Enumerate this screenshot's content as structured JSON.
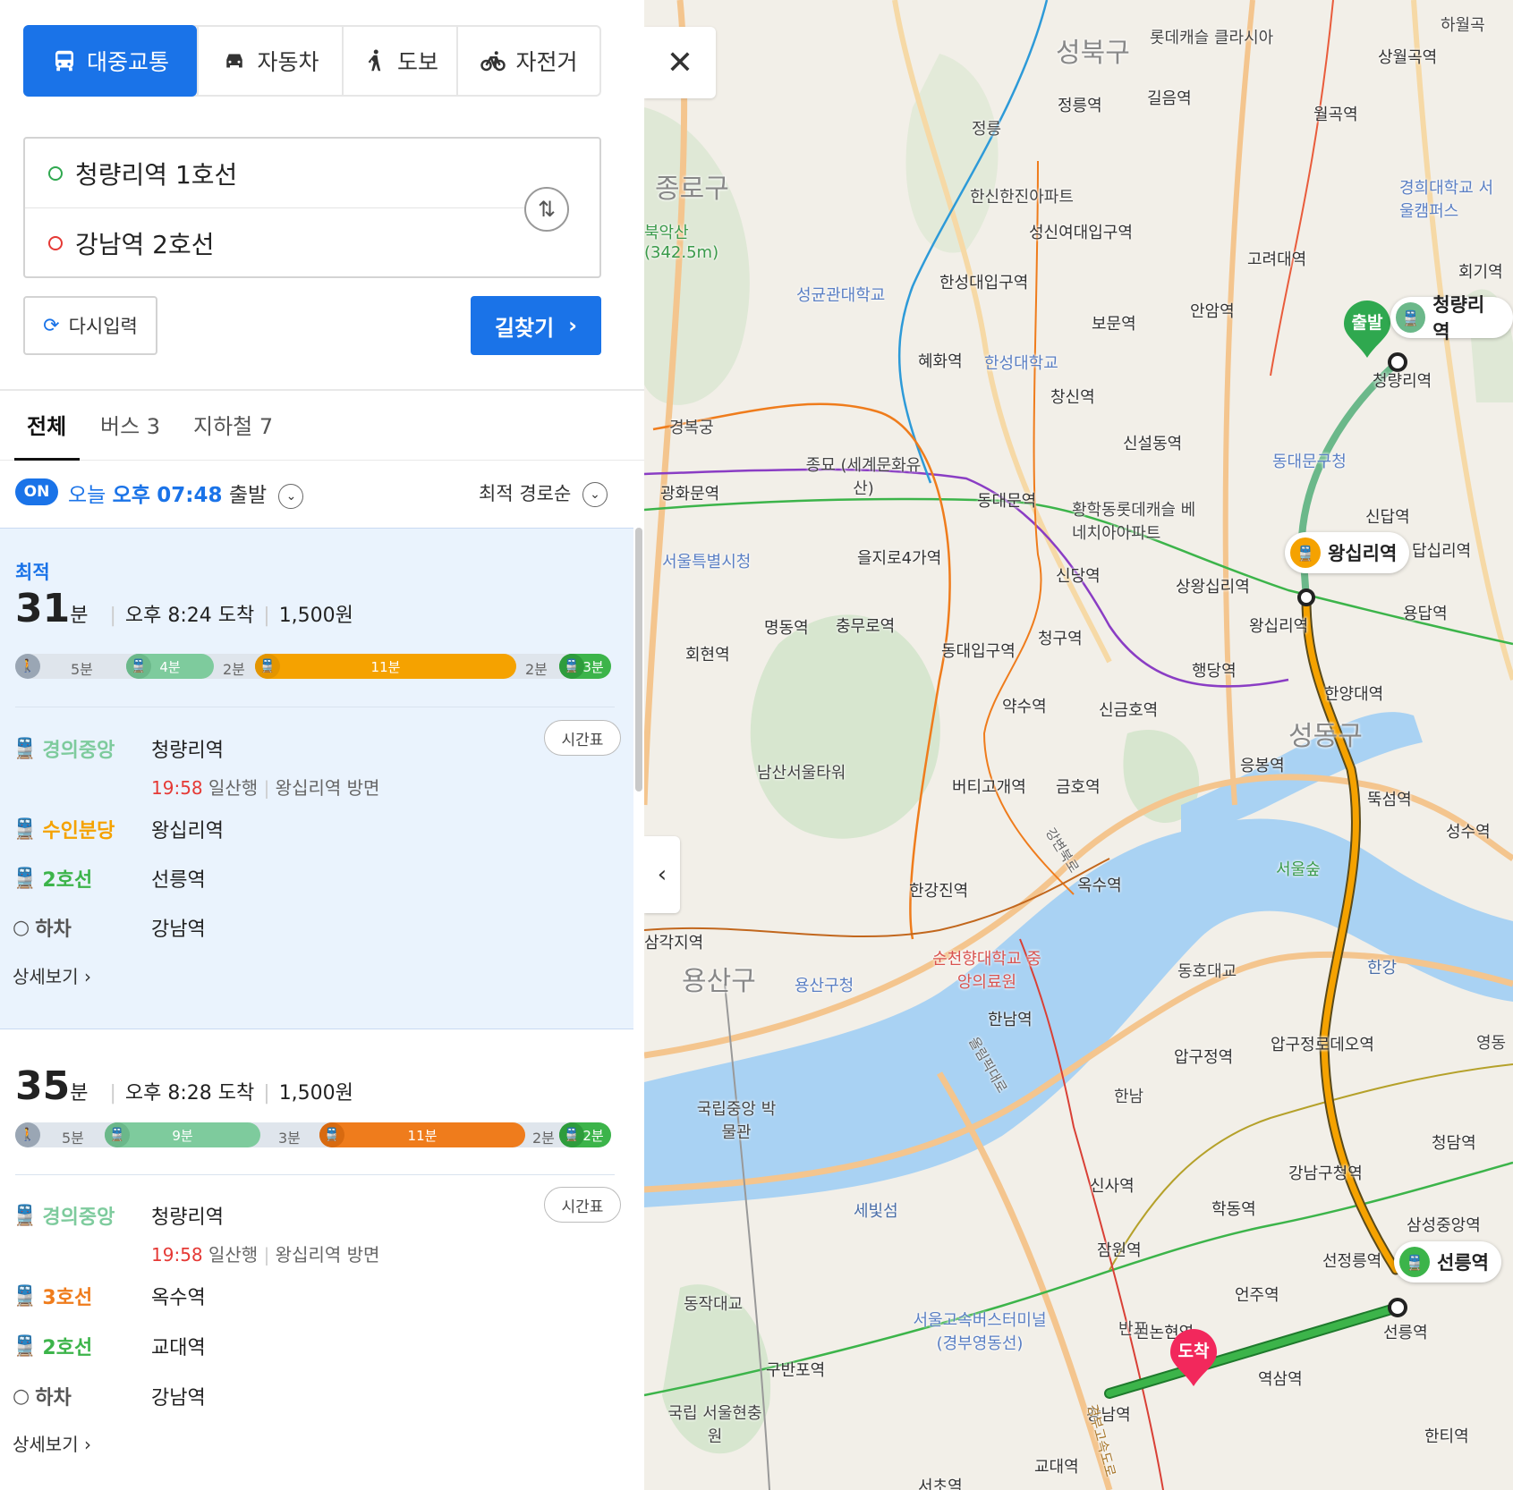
{
  "modes": [
    {
      "label": "대중교통",
      "icon": "bus-icon",
      "active": true
    },
    {
      "label": "자동차",
      "icon": "car-icon",
      "active": false
    },
    {
      "label": "도보",
      "icon": "walk-icon",
      "active": false
    },
    {
      "label": "자전거",
      "icon": "bike-icon",
      "active": false
    }
  ],
  "route": {
    "origin": "청량리역 1호선",
    "destination": "강남역 2호선"
  },
  "buttons": {
    "reset": "다시입력",
    "search": "길찾기"
  },
  "tabs": [
    {
      "label": "전체"
    },
    {
      "label": "버스 3"
    },
    {
      "label": "지하철 7"
    }
  ],
  "departure": {
    "badge": "ON",
    "prefix": "오늘",
    "ampm": "오후",
    "time": "07:48",
    "suffix": "출발",
    "sort": "최적 경로순"
  },
  "results": [
    {
      "tag": "최적",
      "minutes": "31",
      "unit": "분",
      "arrival": "오후 8:24 도착",
      "fare": "1,500원",
      "segments": [
        {
          "type": "walk",
          "label": "5분"
        },
        {
          "type": "rail",
          "label": "4분",
          "color": "#7ecb9d"
        },
        {
          "type": "walk",
          "label": "2분"
        },
        {
          "type": "rail",
          "label": "11분",
          "color": "#f5a200"
        },
        {
          "type": "walk",
          "label": "2분"
        },
        {
          "type": "rail",
          "label": "3분",
          "color": "#3cb44a"
        }
      ],
      "steps": [
        {
          "line": "경의중앙",
          "color": "#7ecb9d",
          "station": "청량리역",
          "time": "19:58",
          "info": "일산행",
          "direction": "왕십리역 방면",
          "timetable": "시간표"
        },
        {
          "line": "수인분당",
          "color": "#f5a200",
          "station": "왕십리역"
        },
        {
          "line": "2호선",
          "color": "#3cb44a",
          "station": "선릉역"
        },
        {
          "line": "하차",
          "color": "#555",
          "station": "강남역"
        }
      ],
      "detail": "상세보기"
    },
    {
      "minutes": "35",
      "unit": "분",
      "arrival": "오후 8:28 도착",
      "fare": "1,500원",
      "segments": [
        {
          "type": "walk",
          "label": "5분"
        },
        {
          "type": "rail",
          "label": "9분",
          "color": "#7ecb9d"
        },
        {
          "type": "walk",
          "label": "3분"
        },
        {
          "type": "rail",
          "label": "11분",
          "color": "#ef7c1c"
        },
        {
          "type": "walk",
          "label": "2분"
        },
        {
          "type": "rail",
          "label": "2분",
          "color": "#3cb44a"
        }
      ],
      "steps": [
        {
          "line": "경의중앙",
          "color": "#7ecb9d",
          "station": "청량리역",
          "time": "19:58",
          "info": "일산행",
          "direction": "왕십리역 방면",
          "timetable": "시간표"
        },
        {
          "line": "3호선",
          "color": "#ef7c1c",
          "station": "옥수역"
        },
        {
          "line": "2호선",
          "color": "#3cb44a",
          "station": "교대역"
        },
        {
          "line": "하차",
          "color": "#555",
          "station": "강남역"
        }
      ],
      "detail": "상세보기"
    }
  ],
  "map": {
    "districts": [
      "성북구",
      "종로구",
      "성동구",
      "용산구"
    ],
    "markers": {
      "start_pin": "출발",
      "start_station": "청량리역",
      "transfer_station": "왕십리역",
      "end_station": "선릉역",
      "end_pin": "도착"
    },
    "labels": [
      "롯데캐슬 클라시아",
      "정릉역",
      "정릉",
      "길음역",
      "하월곡",
      "상월곡역",
      "월곡역",
      "한신한진아파트",
      "성신여대입구역",
      "경희대학교 서울캠퍼스",
      "북악산 (342.5m)",
      "고려대역",
      "회기역",
      "성균관대학교",
      "한성대입구역",
      "보문역",
      "안암역",
      "청량리역",
      "혜화역",
      "한성대학교",
      "창신역",
      "경복궁",
      "신설동역",
      "동대문구청",
      "종묘 (세계문화유산)",
      "광화문역",
      "동대문역",
      "황학동롯데캐슬 베네치아아파트",
      "신답역",
      "답십리역",
      "서울특별시청",
      "을지로4가역",
      "신당역",
      "상왕십리역",
      "왕십리역",
      "용답역",
      "명동역",
      "충무로역",
      "회현역",
      "동대입구역",
      "청구역",
      "행당역",
      "한양대역",
      "약수역",
      "신금호역",
      "응봉역",
      "남산서울타워",
      "버티고개역",
      "금호역",
      "뚝섬역",
      "성수역",
      "서울숲",
      "한강진역",
      "옥수역",
      "동호대교",
      "한강",
      "삼각지역",
      "순천향대학교 중앙의료원",
      "용산구청",
      "한남역",
      "압구정역",
      "압구정로데오역",
      "영동",
      "한남",
      "국립중앙 박물관",
      "신사역",
      "강남구청역",
      "청담역",
      "세빛섬",
      "학동역",
      "삼성중앙역",
      "잠원역",
      "선정릉역",
      "동작대교",
      "서울고속버스터미널 (경부영동선)",
      "언주역",
      "신논현역",
      "반포",
      "선릉역",
      "구반포역",
      "역삼역",
      "국립 서울현충원",
      "강남역",
      "한티역",
      "교대역",
      "서초역",
      "강변북로",
      "올림픽대로",
      "경부고속도로"
    ]
  }
}
